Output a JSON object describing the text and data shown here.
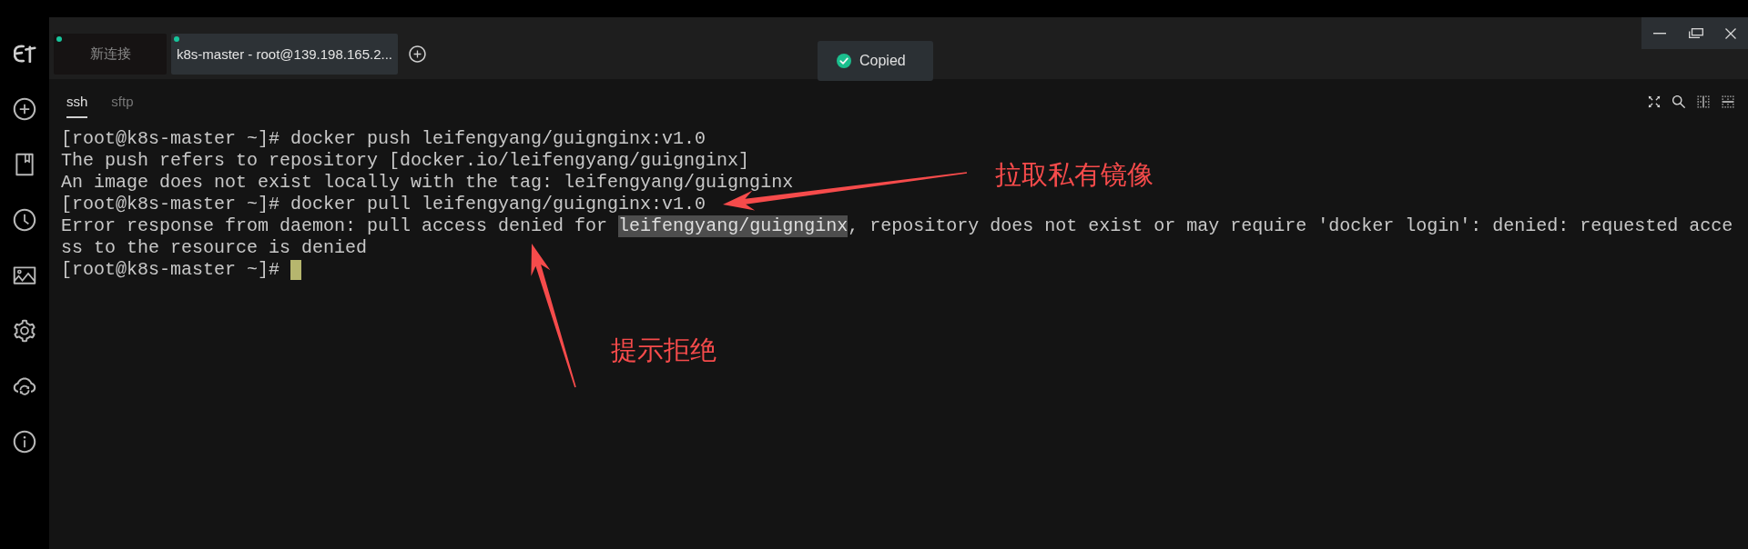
{
  "tabs": [
    {
      "label": "新连接",
      "selected": false
    },
    {
      "label": "k8s-master - root@139.198.165.2...",
      "selected": true
    }
  ],
  "toast": {
    "message": "Copied"
  },
  "session_tabs": [
    {
      "label": "ssh",
      "selected": true
    },
    {
      "label": "sftp",
      "selected": false
    }
  ],
  "terminal": {
    "lines": [
      {
        "segments": [
          {
            "text": "[root@k8s-master ~]# docker push leifengyang/guignginx:v1.0",
            "selected": false
          }
        ]
      },
      {
        "segments": [
          {
            "text": "The push refers to repository [docker.io/leifengyang/guignginx]",
            "selected": false
          }
        ]
      },
      {
        "segments": [
          {
            "text": "An image does not exist locally with the tag: leifengyang/guignginx",
            "selected": false
          }
        ]
      },
      {
        "segments": [
          {
            "text": "[root@k8s-master ~]# docker pull leifengyang/guignginx:v1.0",
            "selected": false
          }
        ]
      },
      {
        "segments": [
          {
            "text": "Error response from daemon: pull access denied for ",
            "selected": false
          },
          {
            "text": "leifengyang/guignginx",
            "selected": true
          },
          {
            "text": ", repository does not exist or may require 'docker login': denied: requested acce",
            "selected": false
          }
        ]
      },
      {
        "segments": [
          {
            "text": "ss to the resource is denied",
            "selected": false
          }
        ]
      },
      {
        "segments": [
          {
            "text": "[root@k8s-master ~]# ",
            "selected": false
          }
        ]
      }
    ],
    "cursor": true
  },
  "annotations": [
    {
      "text": "拉取私有镜像"
    },
    {
      "text": "提示拒绝"
    }
  ]
}
